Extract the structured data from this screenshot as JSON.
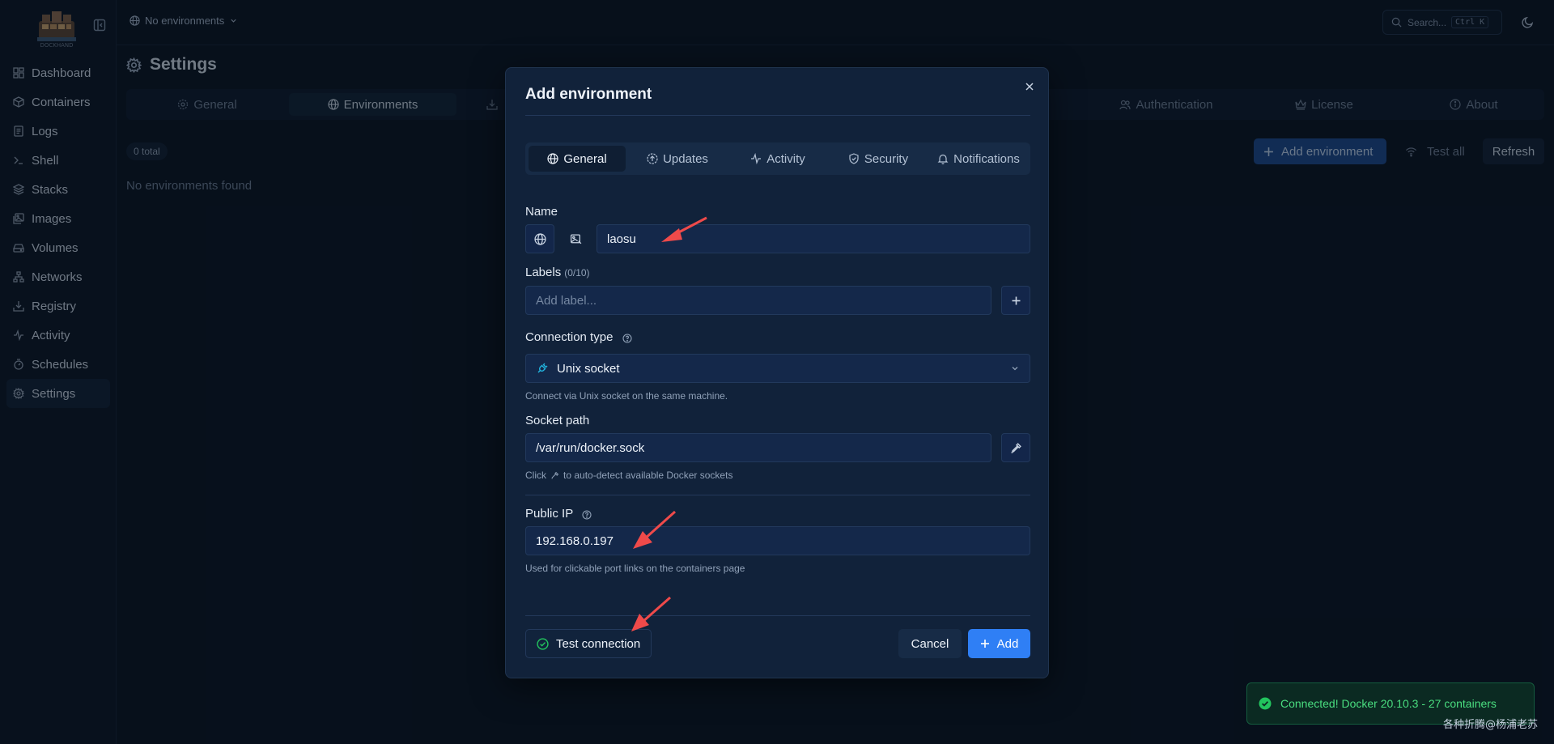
{
  "sidebar": {
    "brand_text": "DOCKHAND",
    "items": [
      {
        "label": "Dashboard",
        "icon": "dashboard-icon"
      },
      {
        "label": "Containers",
        "icon": "box-icon"
      },
      {
        "label": "Logs",
        "icon": "logs-icon"
      },
      {
        "label": "Shell",
        "icon": "terminal-icon"
      },
      {
        "label": "Stacks",
        "icon": "layers-icon"
      },
      {
        "label": "Images",
        "icon": "images-icon"
      },
      {
        "label": "Volumes",
        "icon": "hard-drive-icon"
      },
      {
        "label": "Networks",
        "icon": "network-icon"
      },
      {
        "label": "Registry",
        "icon": "download-icon"
      },
      {
        "label": "Activity",
        "icon": "activity-icon"
      },
      {
        "label": "Schedules",
        "icon": "timer-icon"
      },
      {
        "label": "Settings",
        "icon": "gear-icon",
        "active": true
      }
    ]
  },
  "topbar": {
    "environment": "No environments",
    "search_placeholder": "Search...",
    "search_shortcut": "Ctrl K"
  },
  "page": {
    "title": "Settings",
    "tabs": [
      {
        "label": "General",
        "icon": "gear-icon"
      },
      {
        "label": "Environments",
        "icon": "globe-icon",
        "active": true
      },
      {
        "label": "",
        "icon": "download-icon"
      },
      {
        "label": "Authentication",
        "icon": "users-icon"
      },
      {
        "label": "License",
        "icon": "crown-icon"
      },
      {
        "label": "About",
        "icon": "info-icon"
      }
    ],
    "total_badge": "0 total",
    "empty_text": "No environments found",
    "add_environment_label": "Add environment",
    "test_all_label": "Test all",
    "refresh_label": "Refresh"
  },
  "modal": {
    "title": "Add environment",
    "tabs": [
      {
        "label": "General",
        "active": true
      },
      {
        "label": "Updates"
      },
      {
        "label": "Activity"
      },
      {
        "label": "Security"
      },
      {
        "label": "Notifications"
      }
    ],
    "name_label": "Name",
    "name_value": "laosu",
    "labels_label": "Labels",
    "labels_count": "(0/10)",
    "labels_placeholder": "Add label...",
    "connection_type_label": "Connection type",
    "connection_type_value": "Unix socket",
    "connection_type_hint": "Connect via Unix socket on the same machine.",
    "socket_path_label": "Socket path",
    "socket_path_value": "/var/run/docker.sock",
    "socket_hint_prefix": "Click",
    "socket_hint_suffix": "to auto-detect available Docker sockets",
    "public_ip_label": "Public IP",
    "public_ip_value": "192.168.0.197",
    "public_ip_hint": "Used for clickable port links on the containers page",
    "test_connection_label": "Test connection",
    "cancel_label": "Cancel",
    "add_label": "Add"
  },
  "toast": {
    "message": "Connected! Docker 20.10.3 - 27 containers",
    "status_color": "#4ade80"
  },
  "watermark": "各种折腾@杨浦老苏",
  "colors": {
    "accent": "#2f7ff5",
    "annotation_arrow": "#ef4a4a",
    "success": "#22c55e"
  }
}
